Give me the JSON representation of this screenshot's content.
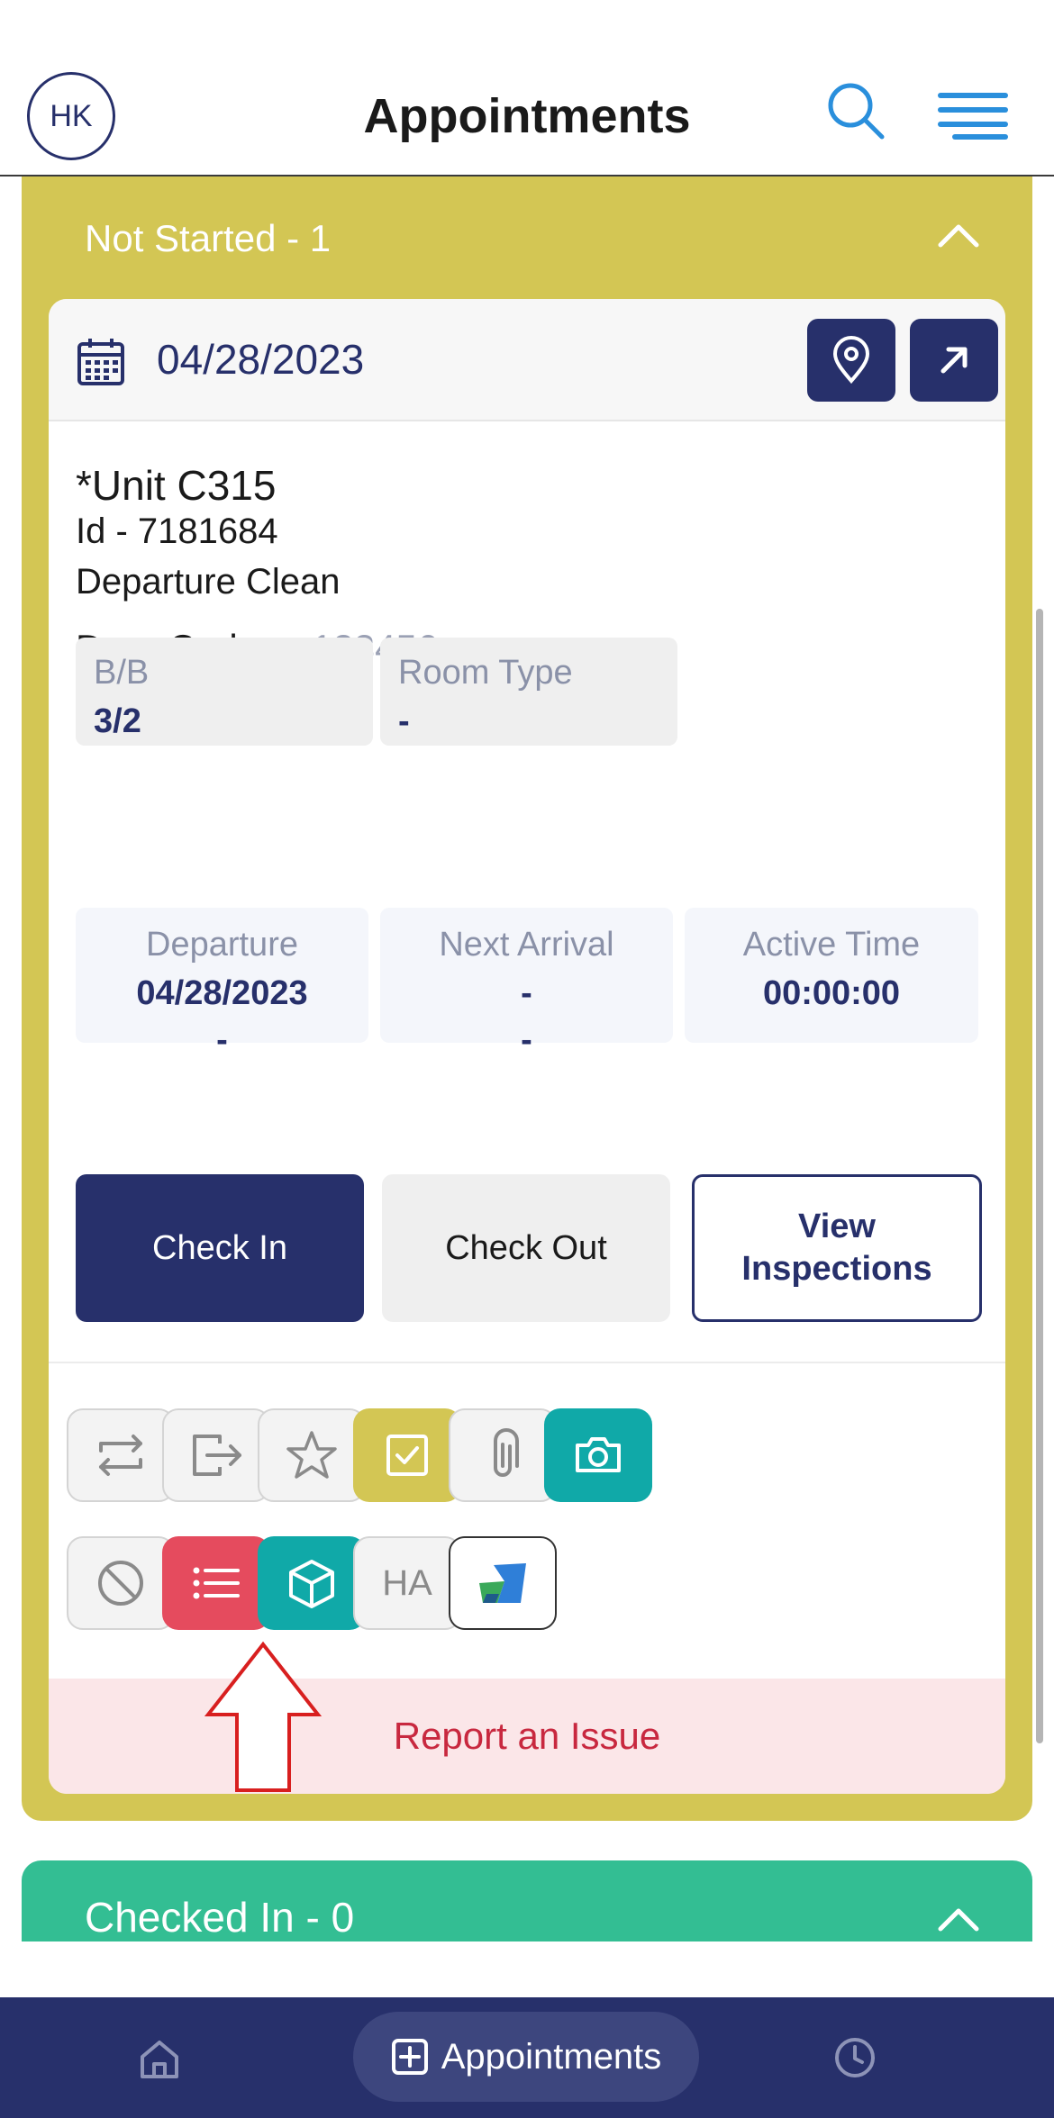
{
  "header": {
    "avatar_initials": "HK",
    "title": "Appointments"
  },
  "sections": {
    "not_started": {
      "label": "Not Started - 1",
      "color": "#d3c654"
    },
    "checked_in": {
      "label": "Checked In - 0",
      "color": "#33be93"
    }
  },
  "card": {
    "date": "04/28/2023",
    "unit": "*Unit C315",
    "id": "Id - 7181684",
    "service": "Departure Clean",
    "door_code_label": "Door Code :",
    "door_code_value": "123456",
    "bb_label": "B/B",
    "bb_value": "3/2",
    "room_type_label": "Room Type",
    "room_type_value": "-",
    "departure_label": "Departure",
    "departure_value": "04/28/2023",
    "departure_value2": "-",
    "next_arrival_label": "Next Arrival",
    "next_arrival_value": "-",
    "next_arrival_value2": "-",
    "active_time_label": "Active Time",
    "active_time_value": "00:00:00",
    "check_in_label": "Check In",
    "check_out_label": "Check Out",
    "view_inspections_line1": "View",
    "view_inspections_line2": "Inspections",
    "ha_label": "HA",
    "report_issue_label": "Report an Issue"
  },
  "icons": [
    "calendar-icon",
    "map-pin-icon",
    "arrow-up-right-icon",
    "swap-icon",
    "exit-icon",
    "star-icon",
    "checkbox-icon",
    "paperclip-icon",
    "camera-icon",
    "block-icon",
    "list-icon",
    "box-icon",
    "ha-icon",
    "app-logo-icon",
    "home-icon",
    "add-square-icon",
    "clock-icon"
  ],
  "colors": {
    "navy": "#27306b",
    "yellow": "#d3c654",
    "teal": "#10a9a8",
    "green": "#33be93",
    "red": "#e54b5e",
    "issue_text": "#c8283f"
  },
  "bottom_nav": {
    "active_label": "Appointments"
  }
}
